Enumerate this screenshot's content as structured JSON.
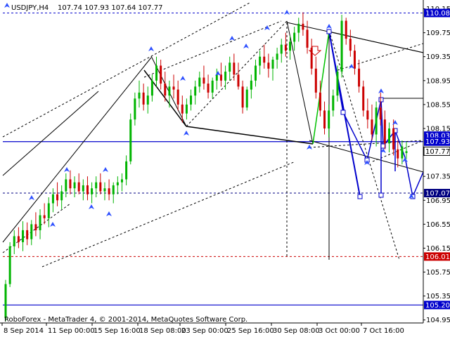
{
  "chart_data": {
    "type": "candlestick",
    "symbol": "USDJPY,H4",
    "ohlc": "107.74 107.93 107.64 107.77",
    "copyright": "RoboForex - MetaTrader 4, © 2001-2014, MetaQuotes Software Corp.",
    "y_range": [
      104.9,
      110.25
    ],
    "y_ticks": [
      "110.15",
      "109.75",
      "109.35",
      "108.95",
      "108.55",
      "108.15",
      "107.35",
      "106.95",
      "106.55",
      "106.15",
      "105.75",
      "105.35",
      "104.95"
    ],
    "highlighted_labels": [
      "110.08",
      "108.03",
      "107.93",
      "107.77",
      "107.07",
      "106.01",
      "105.20"
    ],
    "x_ticks": [
      "8 Sep 2014",
      "11 Sep 00:00",
      "15 Sep 16:00",
      "18 Sep 08:00",
      "23 Sep 00:00",
      "25 Sep 16:00",
      "30 Sep 08:00",
      "3 Oct 00:00",
      "7 Oct 16:00"
    ],
    "horizontal_levels": [
      {
        "value": 110.08,
        "style": "dashed",
        "color": "#0000cc"
      },
      {
        "value": 107.93,
        "style": "solid",
        "color": "#0000cc"
      },
      {
        "value": 107.07,
        "style": "dashed",
        "color": "#000080"
      },
      {
        "value": 106.01,
        "style": "dashed",
        "color": "#cc0000"
      },
      {
        "value": 105.2,
        "style": "solid",
        "color": "#0000cc"
      }
    ],
    "candles": [
      [
        104.98,
        105.62,
        104.93,
        105.55
      ],
      [
        105.55,
        106.25,
        105.5,
        106.18
      ],
      [
        106.18,
        106.45,
        106.05,
        106.35
      ],
      [
        106.35,
        106.5,
        106.15,
        106.25
      ],
      [
        106.25,
        106.6,
        106.1,
        106.45
      ],
      [
        106.45,
        106.58,
        106.2,
        106.3
      ],
      [
        106.3,
        106.62,
        106.2,
        106.55
      ],
      [
        106.55,
        106.75,
        106.35,
        106.45
      ],
      [
        106.45,
        106.8,
        106.3,
        106.7
      ],
      [
        106.7,
        106.9,
        106.55,
        106.65
      ],
      [
        106.65,
        107.0,
        106.5,
        106.9
      ],
      [
        106.9,
        107.15,
        106.75,
        107.05
      ],
      [
        107.05,
        107.25,
        106.85,
        106.95
      ],
      [
        106.95,
        107.2,
        106.8,
        107.1
      ],
      [
        107.1,
        107.4,
        107.0,
        107.3
      ],
      [
        107.3,
        107.45,
        107.05,
        107.15
      ],
      [
        107.15,
        107.35,
        107.0,
        107.25
      ],
      [
        107.25,
        107.4,
        107.05,
        107.1
      ],
      [
        107.1,
        107.3,
        106.95,
        107.2
      ],
      [
        107.2,
        107.35,
        106.95,
        107.05
      ],
      [
        107.05,
        107.25,
        106.9,
        107.15
      ],
      [
        107.15,
        107.35,
        107.0,
        107.25
      ],
      [
        107.25,
        107.4,
        107.05,
        107.1
      ],
      [
        107.1,
        107.25,
        106.95,
        107.15
      ],
      [
        107.15,
        107.3,
        106.95,
        107.05
      ],
      [
        107.05,
        107.25,
        106.9,
        107.2
      ],
      [
        107.2,
        107.35,
        107.05,
        107.25
      ],
      [
        107.25,
        107.4,
        107.1,
        107.3
      ],
      [
        107.3,
        107.7,
        107.2,
        107.6
      ],
      [
        107.6,
        108.4,
        107.55,
        108.3
      ],
      [
        108.3,
        108.75,
        108.2,
        108.65
      ],
      [
        108.65,
        108.95,
        108.5,
        108.75
      ],
      [
        108.75,
        108.9,
        108.45,
        108.55
      ],
      [
        108.55,
        108.85,
        108.4,
        108.7
      ],
      [
        108.7,
        109.05,
        108.6,
        108.95
      ],
      [
        108.95,
        109.35,
        108.85,
        109.2
      ],
      [
        109.2,
        109.3,
        108.8,
        108.9
      ],
      [
        108.9,
        109.1,
        108.6,
        108.7
      ],
      [
        108.7,
        108.95,
        108.5,
        108.85
      ],
      [
        108.85,
        109.05,
        108.65,
        108.8
      ],
      [
        108.8,
        108.95,
        108.45,
        108.55
      ],
      [
        108.55,
        108.7,
        108.25,
        108.4
      ],
      [
        108.4,
        108.65,
        108.3,
        108.55
      ],
      [
        108.55,
        108.8,
        108.45,
        108.7
      ],
      [
        108.7,
        108.95,
        108.55,
        108.85
      ],
      [
        108.85,
        109.1,
        108.75,
        109.0
      ],
      [
        109.0,
        109.2,
        108.8,
        108.9
      ],
      [
        108.9,
        109.05,
        108.65,
        108.75
      ],
      [
        108.75,
        109.0,
        108.65,
        108.95
      ],
      [
        108.95,
        109.15,
        108.8,
        109.05
      ],
      [
        109.05,
        109.25,
        108.85,
        108.95
      ],
      [
        108.95,
        109.2,
        108.8,
        109.1
      ],
      [
        109.1,
        109.35,
        108.95,
        109.25
      ],
      [
        109.25,
        109.4,
        108.95,
        109.05
      ],
      [
        109.05,
        109.25,
        108.8,
        108.85
      ],
      [
        108.85,
        108.95,
        108.4,
        108.5
      ],
      [
        108.5,
        108.85,
        108.45,
        108.8
      ],
      [
        108.8,
        109.05,
        108.65,
        108.95
      ],
      [
        108.95,
        109.3,
        108.85,
        109.2
      ],
      [
        109.2,
        109.45,
        109.05,
        109.35
      ],
      [
        109.35,
        109.55,
        109.15,
        109.25
      ],
      [
        109.25,
        109.4,
        109.0,
        109.15
      ],
      [
        109.15,
        109.35,
        108.95,
        109.3
      ],
      [
        109.3,
        109.5,
        109.15,
        109.4
      ],
      [
        109.4,
        109.65,
        109.25,
        109.55
      ],
      [
        109.55,
        109.75,
        109.35,
        109.45
      ],
      [
        109.45,
        109.7,
        109.3,
        109.6
      ],
      [
        109.6,
        109.85,
        109.45,
        109.75
      ],
      [
        109.75,
        110.0,
        109.6,
        109.9
      ],
      [
        109.9,
        110.09,
        109.7,
        109.8
      ],
      [
        109.8,
        109.95,
        109.4,
        109.5
      ],
      [
        109.5,
        109.65,
        109.05,
        109.15
      ],
      [
        109.15,
        109.35,
        108.65,
        108.75
      ],
      [
        108.75,
        108.95,
        108.35,
        108.45
      ],
      [
        108.45,
        108.6,
        108.05,
        108.15
      ],
      [
        108.15,
        108.55,
        108.0,
        108.45
      ],
      [
        108.45,
        108.8,
        108.35,
        108.7
      ],
      [
        108.7,
        109.2,
        108.6,
        109.1
      ],
      [
        109.1,
        110.05,
        109.0,
        109.95
      ],
      [
        109.95,
        110.0,
        109.55,
        109.65
      ],
      [
        109.65,
        109.8,
        109.35,
        109.45
      ],
      [
        109.45,
        109.55,
        109.05,
        109.15
      ],
      [
        109.15,
        109.3,
        108.75,
        108.85
      ],
      [
        108.85,
        108.95,
        108.35,
        108.45
      ],
      [
        108.45,
        108.65,
        108.15,
        108.3
      ],
      [
        108.3,
        108.55,
        107.95,
        108.05
      ],
      [
        108.05,
        108.6,
        107.85,
        108.5
      ],
      [
        108.5,
        108.75,
        108.2,
        108.3
      ],
      [
        108.3,
        108.45,
        107.8,
        107.9
      ],
      [
        107.9,
        108.25,
        107.75,
        108.15
      ],
      [
        108.15,
        108.3,
        107.7,
        107.8
      ],
      [
        107.8,
        107.95,
        107.5,
        107.65
      ],
      [
        107.65,
        107.95,
        107.55,
        107.85
      ],
      [
        107.74,
        107.93,
        107.64,
        107.77
      ]
    ]
  }
}
